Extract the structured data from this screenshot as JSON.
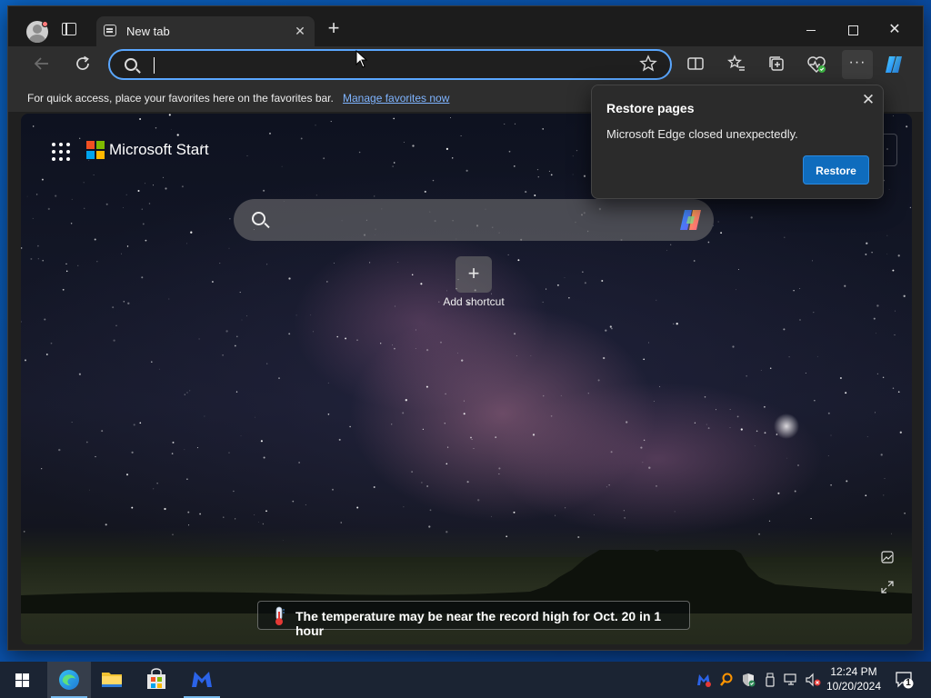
{
  "browser": {
    "tab": {
      "title": "New tab",
      "close_glyph": "✕"
    },
    "new_tab_glyph": "+",
    "window_controls": {
      "close_glyph": "✕"
    },
    "address_bar": {
      "value": "",
      "placeholder": ""
    },
    "toolbar_icons": [
      "back-arrow-icon",
      "refresh-icon",
      "favorite-star-icon",
      "split-screen-icon",
      "favorites-icon",
      "collections-icon",
      "browser-essentials-icon",
      "more-icon",
      "copilot-icon"
    ],
    "more_glyph": "···"
  },
  "favorites_bar": {
    "hint_text": "For quick access, place your favorites here on the favorites bar.",
    "link_text": "Manage favorites now"
  },
  "new_tab_page": {
    "brand": "Microsoft Start",
    "add_shortcut_label": "Add shortcut",
    "add_shortcut_glyph": "+",
    "news_headline": "The temperature may be near the record high for Oct. 20 in 1 hour"
  },
  "restore_popup": {
    "title": "Restore pages",
    "message": "Microsoft Edge closed unexpectedly.",
    "button_label": "Restore",
    "close_glyph": "✕"
  },
  "taskbar": {
    "apps": [
      "start",
      "edge",
      "file-explorer",
      "microsoft-store",
      "malwarebytes"
    ],
    "time": "12:24 PM",
    "date": "10/20/2024",
    "notification_count": "1"
  },
  "colors": {
    "accent": "#0f6cbd",
    "address_focus": "#5aa7ff",
    "link": "#7fb4ff",
    "taskbar": "#1b2433",
    "desktop": "#0a4da4"
  }
}
